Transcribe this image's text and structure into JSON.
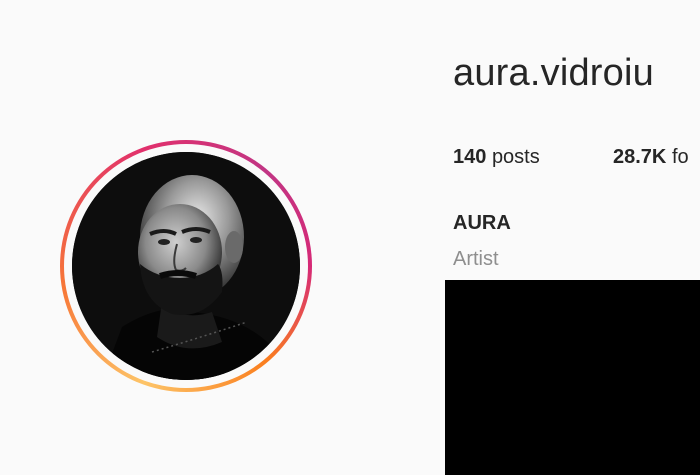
{
  "profile": {
    "username": "aura.vidroiu",
    "full_name": "AURA",
    "category": "Artist"
  },
  "stats": {
    "posts_count": "140",
    "posts_label": "posts",
    "followers_count": "28.7K",
    "followers_label": "fo"
  },
  "colors": {
    "background": "#fafafa",
    "text": "#262626",
    "muted_text": "#8e8e8e",
    "ring_gradient": [
      "#fdc468",
      "#f77737",
      "#e1306c",
      "#c13584"
    ]
  }
}
